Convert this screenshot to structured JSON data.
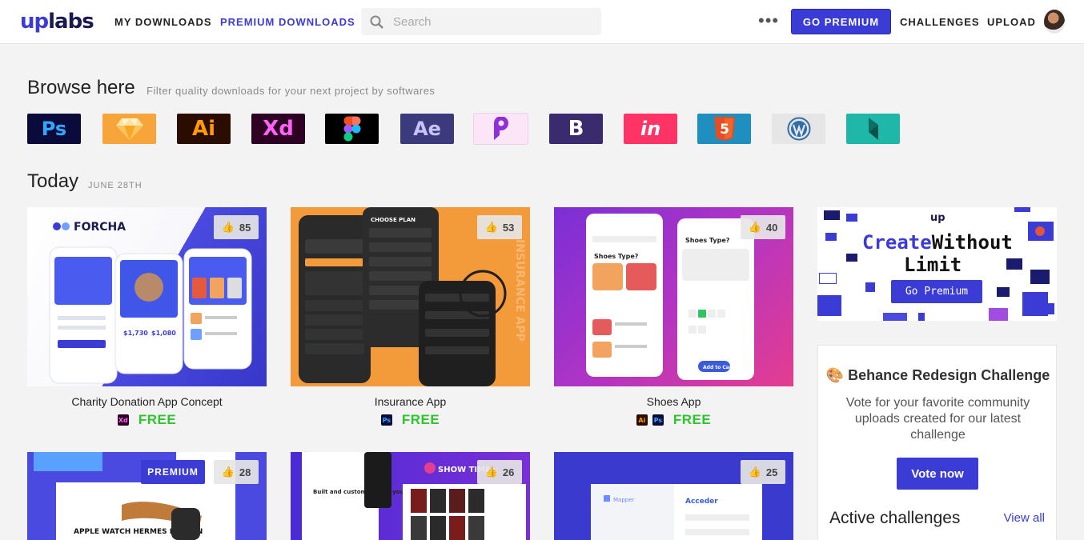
{
  "nav": {
    "logo_up": "up",
    "logo_labs": "labs",
    "my_downloads": "MY DOWNLOADS",
    "premium_downloads": "PREMIUM DOWNLOADS",
    "search_placeholder": "Search",
    "more": "•••",
    "go_premium": "GO PREMIUM",
    "challenges": "CHALLENGES",
    "upload": "UPLOAD"
  },
  "browse": {
    "title": "Browse here",
    "subtitle": "Filter quality downloads for your next project by softwares",
    "software": [
      {
        "label": "Ps",
        "bg": "#0b0b3b",
        "fg": "#31a8ff"
      },
      {
        "label": "",
        "bg": "#f7a43b",
        "fg": "#fde3a1",
        "icon": "sketch-icon"
      },
      {
        "label": "Ai",
        "bg": "#2a0c00",
        "fg": "#ff9a00"
      },
      {
        "label": "Xd",
        "bg": "#2e0024",
        "fg": "#ff61f6"
      },
      {
        "label": "",
        "bg": "#000000",
        "fg": "#ffffff",
        "icon": "figma-icon"
      },
      {
        "label": "Ae",
        "bg": "#3b3a7d",
        "fg": "#c7c3ff"
      },
      {
        "label": "",
        "bg": "#fbe5f6",
        "fg": "#8f2fd6",
        "icon": "protopie-icon"
      },
      {
        "label": "B",
        "bg": "#3c2a6e",
        "fg": "#ffffff"
      },
      {
        "label": "in",
        "bg": "#ff3366",
        "fg": "#ffffff"
      },
      {
        "label": "5",
        "bg": "#1f8fc0",
        "fg": "#ffffff",
        "icon": "html5-icon"
      },
      {
        "label": "",
        "bg": "#e6e6e6",
        "fg": "#2f6ea8",
        "icon": "wordpress-icon"
      },
      {
        "label": "",
        "bg": "#1fb8a8",
        "fg": "#0b6f66",
        "icon": "framer-icon"
      }
    ]
  },
  "today": {
    "title": "Today",
    "date": "JUNE 28TH"
  },
  "cards": [
    {
      "title": "Charity Donation App Concept",
      "likes": "85",
      "price": "FREE",
      "premium": ""
    },
    {
      "title": "Insurance App",
      "likes": "53",
      "price": "FREE",
      "premium": ""
    },
    {
      "title": "Shoes App",
      "likes": "40",
      "price": "FREE",
      "premium": ""
    },
    {
      "title": "",
      "likes": "28",
      "price": "",
      "premium": "PREMIUM"
    },
    {
      "title": "",
      "likes": "26",
      "price": "",
      "premium": ""
    },
    {
      "title": "",
      "likes": "25",
      "price": "",
      "premium": ""
    }
  ],
  "thumbs": {
    "forcha": "FORCHA",
    "insurance_side": "INSURANCE APP",
    "choose_plan": "CHOOSE PLAN",
    "shoes_type": "Shoes Type?",
    "add_to_cart": "Add to Cart",
    "apple_watch": "APPLE WATCH HERMES EDITION",
    "built_for_habits": "Built and customized for your habits",
    "show_time": "SHOW TIME",
    "mapper": "Mapper",
    "acceder": "Acceder"
  },
  "ad": {
    "brand": "up",
    "create": "Create",
    "without": "Without",
    "limits": "Limit",
    "button": "Go Premium"
  },
  "challenge": {
    "title": "🎨 Behance Redesign Challenge",
    "description": "Vote for your favorite community uploads created for our latest challenge",
    "vote_button": "Vote now",
    "active_title": "Active challenges",
    "view_all": "View all"
  },
  "colors": {
    "accent": "#3b3bd6",
    "free_green": "#2fc42f",
    "page_bg": "#f3f3f3"
  }
}
